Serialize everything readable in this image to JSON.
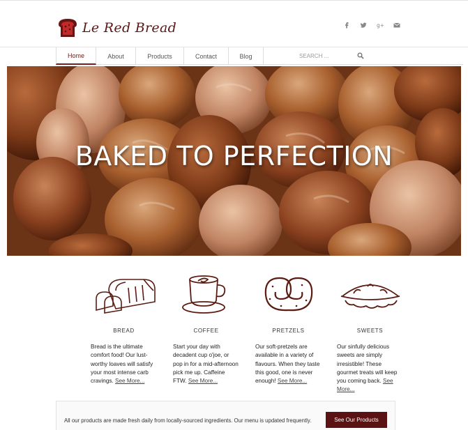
{
  "brand": {
    "name": "Le Red Bread",
    "accent": "#7a1d1d"
  },
  "social": [
    "facebook-icon",
    "twitter-icon",
    "google-plus-icon",
    "email-icon"
  ],
  "nav": {
    "items": [
      "Home",
      "About",
      "Products",
      "Contact",
      "Blog"
    ],
    "active": "Home"
  },
  "search": {
    "placeholder": "SEARCH ..."
  },
  "hero": {
    "title": "BAKED TO PERFECTION"
  },
  "products": [
    {
      "title": "BREAD",
      "desc": "Bread is the ultimate comfort food! Our lust-worthy loaves will satisfy your most intense carb cravings.",
      "more": "See More..."
    },
    {
      "title": "COFFEE",
      "desc": "Start your day with decadent cup o'joe, or pop in for a mid-afternoon pick me up. Caffeine FTW.",
      "more": "See More..."
    },
    {
      "title": "PRETZELS",
      "desc": "Our soft-pretzels are available in a variety of flavours. When they taste this good, one is never enough!",
      "more": "See More..."
    },
    {
      "title": "SWEETS",
      "desc": "Our sinfully delicious sweets are simply irresistible! These gourmet treats will keep you coming back.",
      "more": "See More..."
    }
  ],
  "cta": {
    "text": "All our products are made fresh daily from locally-sourced ingredients. Our menu is updated frequently.",
    "button": "See Our Products"
  }
}
